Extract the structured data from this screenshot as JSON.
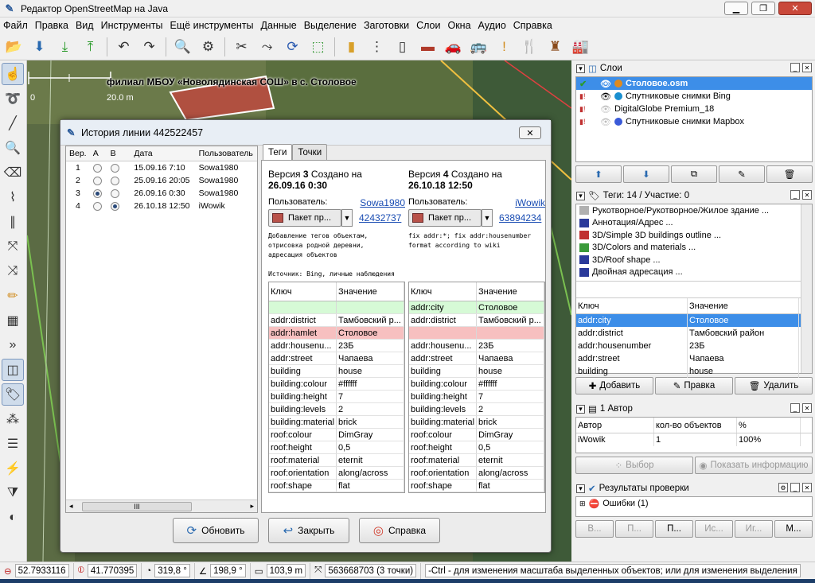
{
  "window": {
    "title": "Редактор OpenStreetMap на Java",
    "minimize": "▁",
    "maximize": "❐",
    "close": "✕"
  },
  "menu": [
    "Файл",
    "Правка",
    "Вид",
    "Инструменты",
    "Ещё инструменты",
    "Данные",
    "Выделение",
    "Заготовки",
    "Слои",
    "Окна",
    "Аудио",
    "Справка"
  ],
  "map": {
    "caption": "филиал МБОУ «Новолядинская СОШ» в с. Столовое",
    "scale_start": "0",
    "scale_end": "20.0 m"
  },
  "dialog": {
    "title": "История линии 442522457",
    "close": "✕",
    "versions": {
      "headers": [
        "Вер.",
        "A",
        "B",
        "Дата",
        "Пользователь"
      ],
      "rows": [
        {
          "ver": "1",
          "a": false,
          "b": false,
          "date": "15.09.16 7:10",
          "user": "Sowa1980"
        },
        {
          "ver": "2",
          "a": false,
          "b": false,
          "date": "25.09.16 20:05",
          "user": "Sowa1980"
        },
        {
          "ver": "3",
          "a": true,
          "b": false,
          "date": "26.09.16 0:30",
          "user": "Sowa1980"
        },
        {
          "ver": "4",
          "a": false,
          "b": true,
          "date": "26.10.18 12:50",
          "user": "iWowik"
        }
      ],
      "scroll_left": "◂",
      "scroll_thumb": "III",
      "scroll_right": "▸"
    },
    "tabs": [
      "Теги",
      "Точки"
    ],
    "left": {
      "header_prefix": "Версия ",
      "version": "3",
      "header_mid": " Создано на",
      "date": "26.09.16 0:30",
      "user_label": "Пользователь:",
      "user": "Sowa1980",
      "changeset": "42432737",
      "package": "Пакет пр...",
      "comment": "Добавление тегов объектам,\nотрисовка родной деревни,\nадресация объектов\n\nИсточник: Bing, личные наблюдения",
      "tags": [
        {
          "k": "",
          "v": "",
          "state": "new"
        },
        {
          "k": "addr:district",
          "v": "Тамбовский р...",
          "state": ""
        },
        {
          "k": "addr:hamlet",
          "v": "Столовое",
          "state": "del"
        },
        {
          "k": "addr:housenu...",
          "v": "23Б",
          "state": ""
        },
        {
          "k": "addr:street",
          "v": "Чапаева",
          "state": ""
        },
        {
          "k": "building",
          "v": "house",
          "state": ""
        },
        {
          "k": "building:colour",
          "v": "#ffffff",
          "state": ""
        },
        {
          "k": "building:height",
          "v": "7",
          "state": ""
        },
        {
          "k": "building:levels",
          "v": "2",
          "state": ""
        },
        {
          "k": "building:material",
          "v": "brick",
          "state": ""
        },
        {
          "k": "roof:colour",
          "v": "DimGray",
          "state": ""
        },
        {
          "k": "roof:height",
          "v": "0,5",
          "state": ""
        },
        {
          "k": "roof:material",
          "v": "eternit",
          "state": ""
        },
        {
          "k": "roof:orientation",
          "v": "along/across",
          "state": ""
        },
        {
          "k": "roof:shape",
          "v": "flat",
          "state": ""
        }
      ]
    },
    "right": {
      "header_prefix": "Версия ",
      "version": "4",
      "header_mid": " Создано на",
      "date": "26.10.18 12:50",
      "user_label": "Пользователь:",
      "user": "iWowik",
      "changeset": "63894234",
      "package": "Пакет пр...",
      "comment": "fix addr:*; fix addr:housenumber\nformat according to wiki",
      "tags": [
        {
          "k": "addr:city",
          "v": "Столовое",
          "state": "new"
        },
        {
          "k": "addr:district",
          "v": "Тамбовский р...",
          "state": ""
        },
        {
          "k": "",
          "v": "",
          "state": "del"
        },
        {
          "k": "addr:housenu...",
          "v": "23Б",
          "state": ""
        },
        {
          "k": "addr:street",
          "v": "Чапаева",
          "state": ""
        },
        {
          "k": "building",
          "v": "house",
          "state": ""
        },
        {
          "k": "building:colour",
          "v": "#ffffff",
          "state": ""
        },
        {
          "k": "building:height",
          "v": "7",
          "state": ""
        },
        {
          "k": "building:levels",
          "v": "2",
          "state": ""
        },
        {
          "k": "building:material",
          "v": "brick",
          "state": ""
        },
        {
          "k": "roof:colour",
          "v": "DimGray",
          "state": ""
        },
        {
          "k": "roof:height",
          "v": "0,5",
          "state": ""
        },
        {
          "k": "roof:material",
          "v": "eternit",
          "state": ""
        },
        {
          "k": "roof:orientation",
          "v": "along/across",
          "state": ""
        },
        {
          "k": "roof:shape",
          "v": "flat",
          "state": ""
        }
      ]
    },
    "col_key": "Ключ",
    "col_value": "Значение",
    "buttons": {
      "refresh": "Обновить",
      "close": "Закрыть",
      "help": "Справка"
    }
  },
  "layers": {
    "title": "Слои",
    "items": [
      {
        "name": "Столовое.osm",
        "selected": true,
        "color": "#e08a1e"
      },
      {
        "name": "Спутниковые снимки Bing",
        "selected": false,
        "color": "#1a8fd0"
      },
      {
        "name": "DigitalGlobe Premium_18",
        "selected": false,
        "color": "#888888"
      },
      {
        "name": "Спутниковые снимки Mapbox",
        "selected": false,
        "color": "#3a5ad8"
      }
    ],
    "buttons": [
      "⬆",
      "⬇",
      "⧉",
      "✎",
      "🗑"
    ]
  },
  "tags": {
    "title": "Теги: 14 / Участие: 0",
    "presets": [
      "Рукотворное/Рукотворное/Жилое здание ...",
      "Аннотация/Адрес ...",
      "3D/Simple 3D buildings outline ...",
      "3D/Colors and materials ...",
      "3D/Roof shape ...",
      "Двойная адресация ..."
    ],
    "col_key": "Ключ",
    "col_value": "Значение",
    "rows": [
      {
        "k": "addr:city",
        "v": "Столовое",
        "sel": true
      },
      {
        "k": "addr:district",
        "v": "Тамбовский район",
        "sel": false
      },
      {
        "k": "addr:housenumber",
        "v": "23Б",
        "sel": false
      },
      {
        "k": "addr:street",
        "v": "Чапаева",
        "sel": false
      },
      {
        "k": "building",
        "v": "house",
        "sel": false
      }
    ],
    "add": "Добавить",
    "edit": "Правка",
    "delete": "Удалить"
  },
  "authors": {
    "title": "1 Автор",
    "headers": [
      "Автор",
      "кол-во объектов",
      "%"
    ],
    "row": {
      "author": "iWowik",
      "count": "1",
      "pct": "100%"
    },
    "select": "Выбор",
    "info": "Показать информацию"
  },
  "validation": {
    "title": "Результаты проверки",
    "errors": "Ошибки (1)",
    "buttons": [
      "В...",
      "П...",
      "П...",
      "Ис...",
      "Иг...",
      "М..."
    ]
  },
  "status": {
    "lat": "52.7933116",
    "lon": "41.770395",
    "heading": "319,8 °",
    "angle": "198,9 °",
    "length": "103,9 m",
    "way": "563668703 (3 точки)",
    "hint": "-Ctrl - для изменения масштаба выделенных объектов; или для изменения выделения"
  },
  "colors": {
    "arrow": "#e8201a",
    "selection": "#3d8ee8",
    "new_row": "#d6fad6",
    "del_row": "#f7c0c0"
  }
}
